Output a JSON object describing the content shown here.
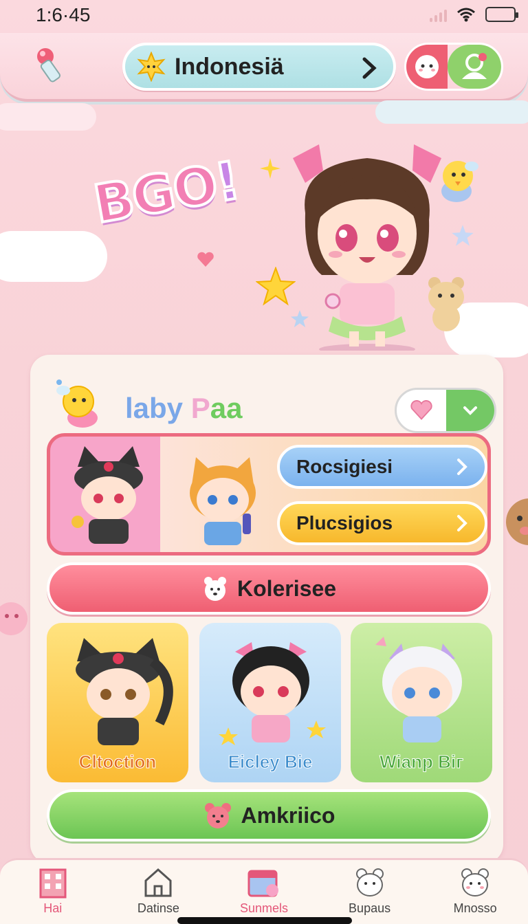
{
  "status_bar": {
    "time": "1:6·45"
  },
  "header": {
    "region_label": "Indonesiä"
  },
  "hero": {
    "logo_text_main": "BGO",
    "logo_text_accent": "!"
  },
  "profile": {
    "name_part1": "laby",
    "name_part2": " P",
    "name_part3": "aa"
  },
  "feature": {
    "btn_primary": "Rocsigiesi",
    "btn_secondary": "Plucsigios"
  },
  "buttons": {
    "pink_label": "Kolerisee",
    "green_label": "Amkriico"
  },
  "characters": [
    {
      "label": "Cltoction"
    },
    {
      "label": "Eicley Bie"
    },
    {
      "label": "Wianp Biг"
    }
  ],
  "tabs": [
    {
      "label": "Hai",
      "icon": "building-icon"
    },
    {
      "label": "Datinse",
      "icon": "house-icon"
    },
    {
      "label": "Sunmels",
      "icon": "calendar-icon"
    },
    {
      "label": "Bupaus",
      "icon": "bear-icon"
    },
    {
      "label": "Mnosso",
      "icon": "bear-icon"
    }
  ],
  "colors": {
    "accent_pink": "#ec6b80",
    "accent_green": "#6cc554",
    "background": "#fbd9de"
  }
}
